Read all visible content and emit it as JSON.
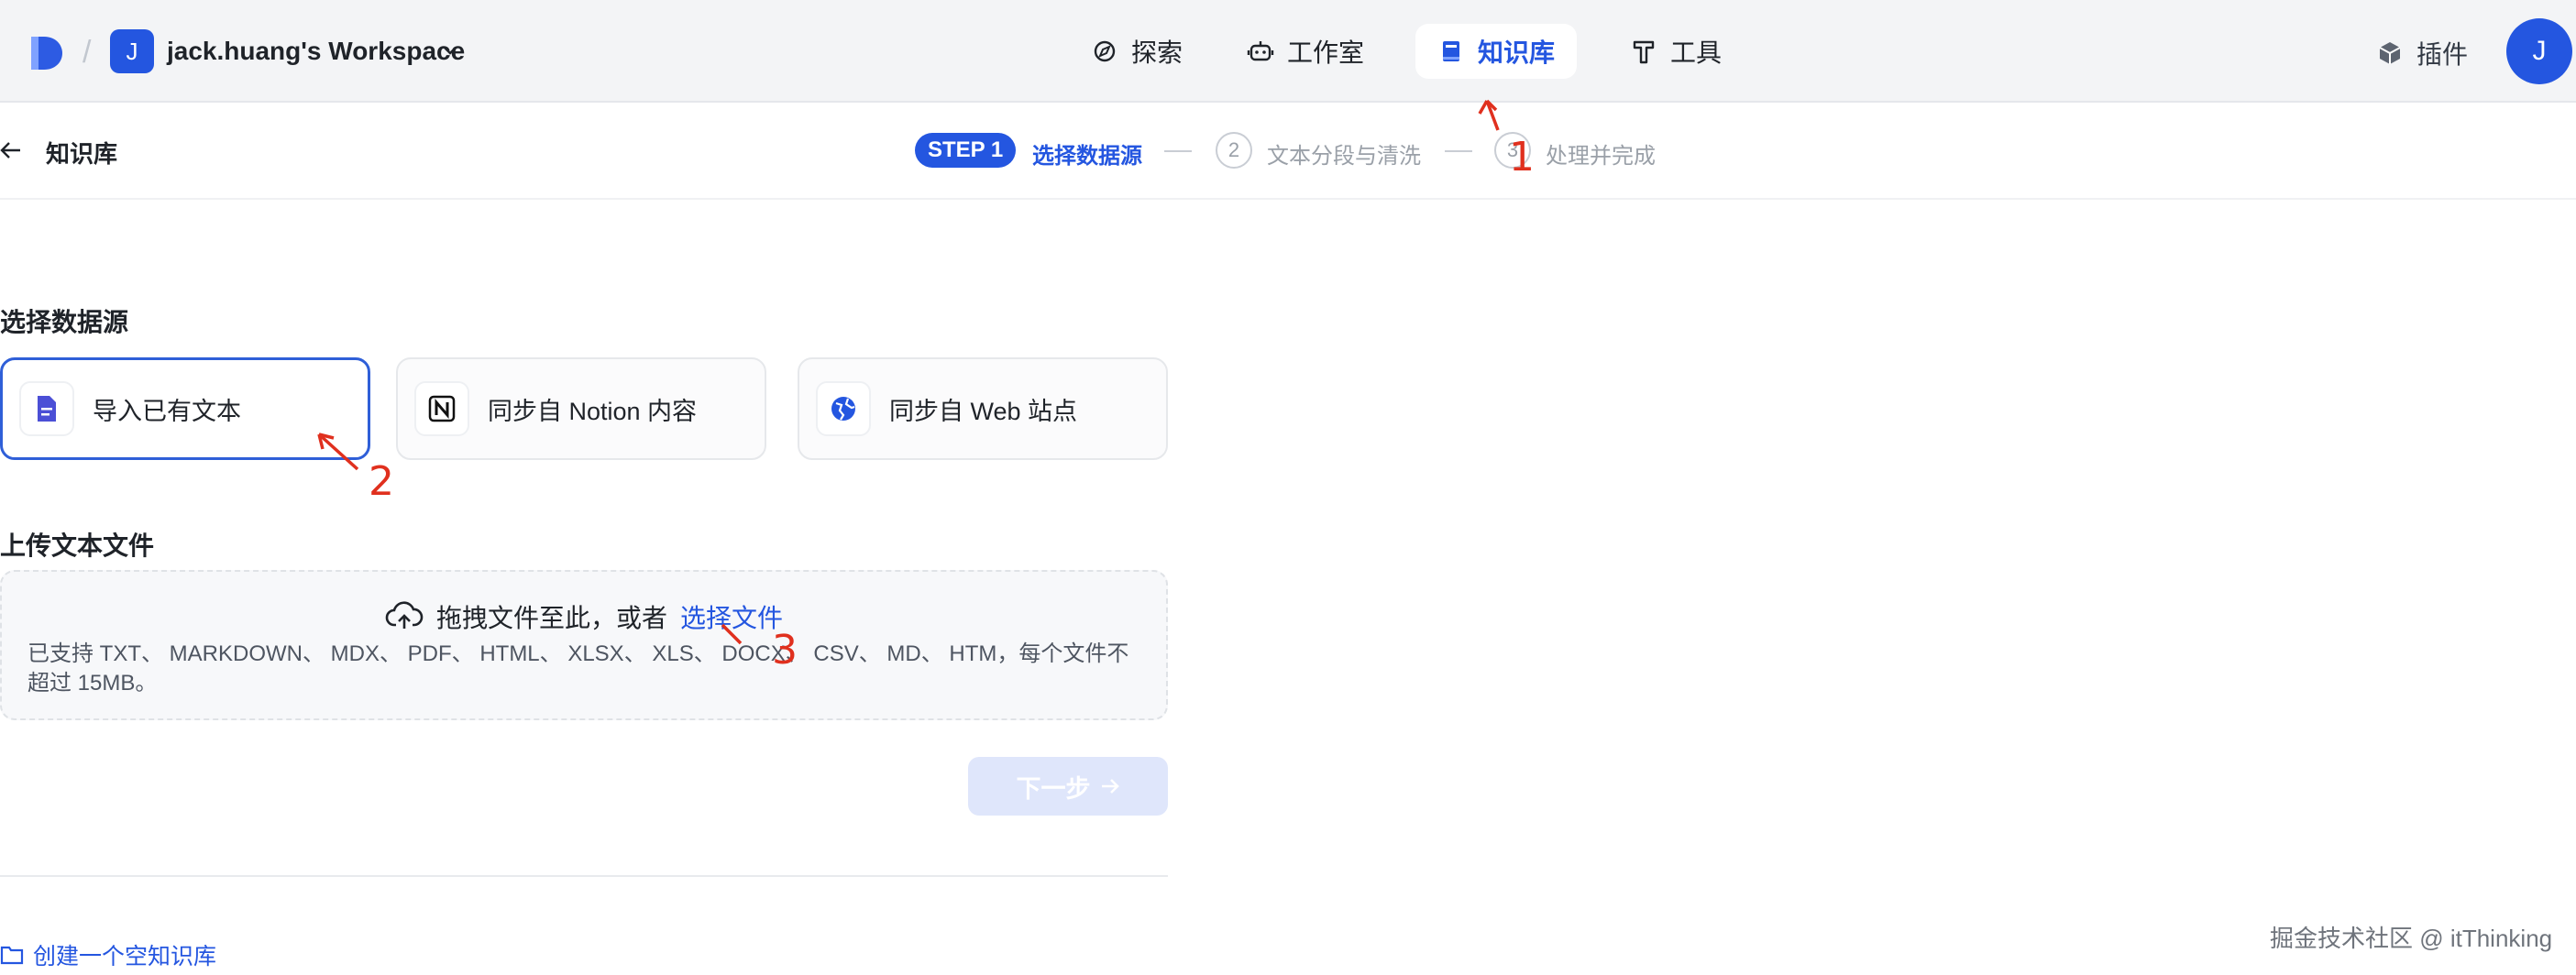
{
  "topbar": {
    "workspace_initial": "J",
    "workspace_name": "jack.huang's Workspace",
    "nav": [
      {
        "label": "探索",
        "icon": "explore-icon",
        "active": false
      },
      {
        "label": "工作室",
        "icon": "robot-icon",
        "active": false
      },
      {
        "label": "知识库",
        "icon": "book-icon",
        "active": true
      },
      {
        "label": "工具",
        "icon": "hammer-icon",
        "active": false
      }
    ],
    "plugin_label": "插件",
    "user_initial": "J"
  },
  "subheader": {
    "back_title": "知识库",
    "steps": [
      {
        "badge": "STEP 1",
        "label": "选择数据源",
        "active": true
      },
      {
        "badge": "2",
        "label": "文本分段与清洗",
        "active": false
      },
      {
        "badge": "3",
        "label": "处理并完成",
        "active": false
      }
    ]
  },
  "datasource": {
    "title": "选择数据源",
    "cards": [
      {
        "label": "导入已有文本",
        "icon": "document-icon",
        "selected": true
      },
      {
        "label": "同步自 Notion 内容",
        "icon": "notion-icon",
        "selected": false
      },
      {
        "label": "同步自 Web 站点",
        "icon": "globe-icon",
        "selected": false
      }
    ]
  },
  "upload": {
    "title": "上传文本文件",
    "drag_text": "拖拽文件至此，或者",
    "select_link": "选择文件",
    "hint": "已支持 TXT、 MARKDOWN、 MDX、 PDF、 HTML、 XLSX、 XLS、 DOCX、 CSV、 MD、 HTM，每个文件不超过 15MB。"
  },
  "next_button": "下一步",
  "create_empty_link": "创建一个空知识库",
  "watermark": "掘金技术社区 @ itThinking",
  "annotations": {
    "one": "1",
    "two": "2",
    "three": "3"
  },
  "colors": {
    "accent": "#2456e0",
    "annotation": "#e0301e",
    "topbar_bg": "#f3f4f6"
  }
}
